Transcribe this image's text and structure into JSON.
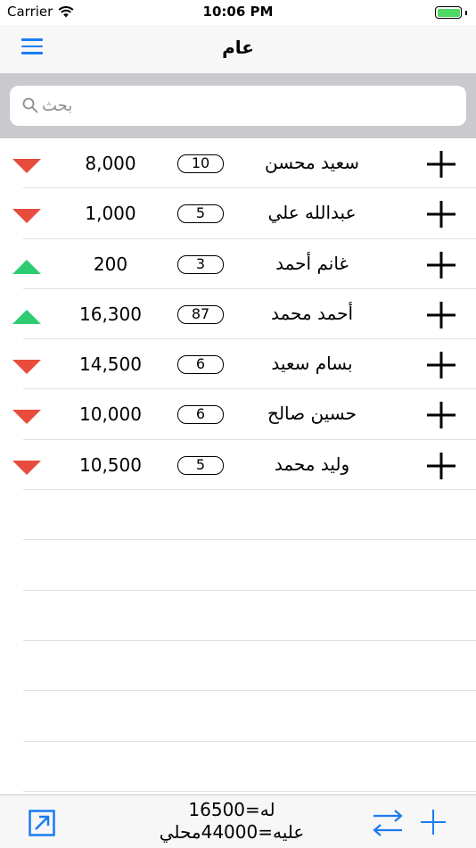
{
  "status": {
    "carrier": "Carrier",
    "time": "10:06 PM"
  },
  "nav": {
    "title": "عام",
    "menu_icon": "hamburger-menu-icon"
  },
  "search": {
    "placeholder": "بحث"
  },
  "colors": {
    "accent": "#1a7bf0",
    "down": "#e74c3c",
    "up": "#2ecc71",
    "battery": "#4cd964"
  },
  "rows": [
    {
      "name": "سعيد محسن",
      "count": "10",
      "amount": "8,000",
      "trend": "down"
    },
    {
      "name": "عبدالله علي",
      "count": "5",
      "amount": "1,000",
      "trend": "down"
    },
    {
      "name": "غانم أحمد",
      "count": "3",
      "amount": "200",
      "trend": "up"
    },
    {
      "name": "أحمد محمد",
      "count": "87",
      "amount": "16,300",
      "trend": "up"
    },
    {
      "name": "بسام سعيد",
      "count": "6",
      "amount": "14,500",
      "trend": "down"
    },
    {
      "name": "حسين صالح",
      "count": "6",
      "amount": "10,000",
      "trend": "down"
    },
    {
      "name": "وليد محمد",
      "count": "5",
      "amount": "10,500",
      "trend": "down"
    }
  ],
  "footer": {
    "line1": "له=16500",
    "line2": "عليه=44000محلي"
  }
}
